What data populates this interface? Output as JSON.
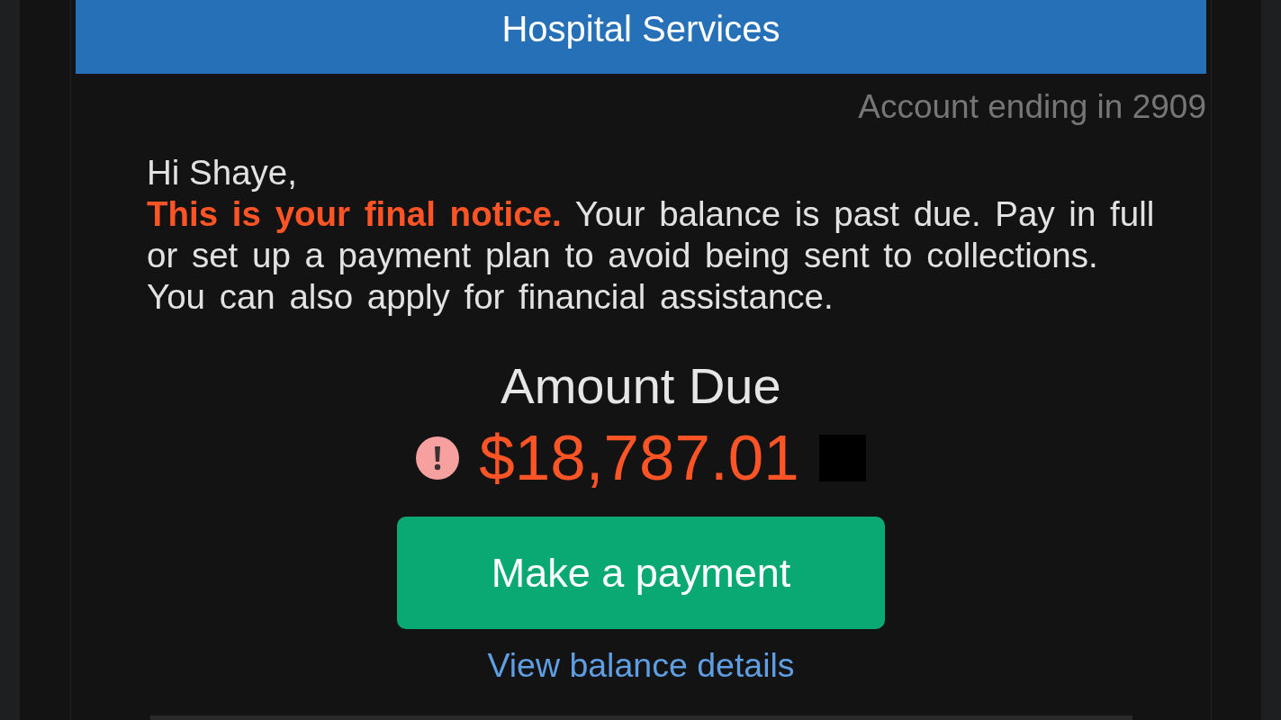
{
  "header": {
    "title": "Hospital Services"
  },
  "account": {
    "label": "Account ending in 2909"
  },
  "message": {
    "greeting": "Hi Shaye,",
    "body": "**This is your final notice.** Your balance is past due. Pay in full or set up a payment plan to avoid being sent to collections. You can also apply for financial assistance."
  },
  "amount_due": {
    "label": "Amount Due",
    "amount": "$18,787.01",
    "overdue": true
  },
  "actions": {
    "primary_button": "Make a payment",
    "link": "View balance details"
  }
}
